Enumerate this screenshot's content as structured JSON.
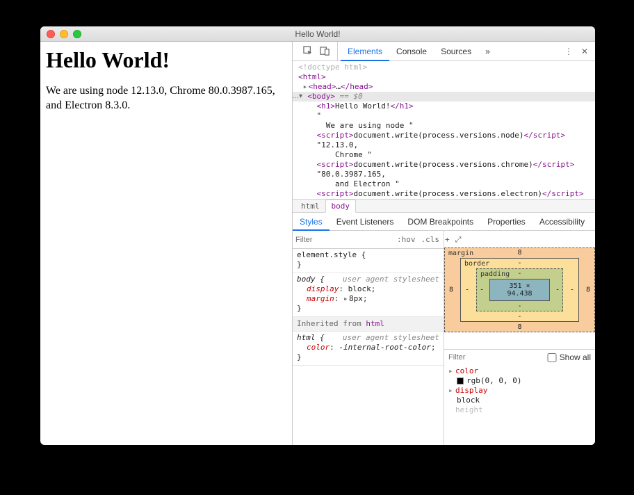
{
  "window": {
    "title": "Hello World!"
  },
  "page": {
    "heading": "Hello World!",
    "paragraph": "We are using node 12.13.0, Chrome 80.0.3987.165, and Electron 8.3.0."
  },
  "devtools": {
    "tabs": [
      "Elements",
      "Console",
      "Sources"
    ],
    "active_tab": 0,
    "elements_tree": {
      "doctype": "<!doctype html>",
      "html_open": "html",
      "head": {
        "open": "head",
        "ellipsis": "…",
        "close": "head"
      },
      "body_open": "body",
      "body_selected_suffix": " == $0",
      "h1": {
        "tag": "h1",
        "text": "Hello World!"
      },
      "quote1": "\"",
      "text_node1": "      We are using node \"",
      "script1": {
        "tag": "script",
        "code": "document.write(process.versions.node)"
      },
      "text_version_node": "\"12.13.0,",
      "text_chrome_label": "        Chrome \"",
      "script2": {
        "tag": "script",
        "code": "document.write(process.versions.chrome)"
      },
      "text_version_chrome": "\"80.0.3987.165,",
      "text_electron_label": "        and Electron \"",
      "script3": {
        "tag": "script",
        "code": "document.write(process.versions.electron)"
      }
    },
    "breadcrumbs": [
      "html",
      "body"
    ],
    "styles_tabs": [
      "Styles",
      "Event Listeners",
      "DOM Breakpoints",
      "Properties",
      "Accessibility"
    ],
    "filter_placeholder": "Filter",
    "hov_label": ":hov",
    "cls_label": ".cls",
    "rules": {
      "element_style": "element.style {",
      "body_sel": "body {",
      "ua_label": "user agent stylesheet",
      "body_display": {
        "name": "display",
        "value": "block"
      },
      "body_margin": {
        "name": "margin",
        "value": "8px"
      },
      "inherit_label": "Inherited from ",
      "inherit_link": "html",
      "html_sel": "html {",
      "html_color": {
        "name": "color",
        "value": "-internal-root-color"
      },
      "brace_close": "}"
    },
    "box_model": {
      "margin_label": "margin",
      "border_label": "border",
      "padding_label": "padding",
      "content": "351 × 94.438",
      "margin": {
        "top": "8",
        "right": "8",
        "bottom": "8",
        "left": "8"
      },
      "border": {
        "top": "-",
        "right": "-",
        "bottom": "-",
        "left": "-"
      },
      "padding": {
        "top": "-",
        "right": "-",
        "bottom": "-",
        "left": "-"
      }
    },
    "computed": {
      "filter_placeholder": "Filter",
      "show_all_label": "Show all",
      "props": [
        {
          "name": "color",
          "value": "rgb(0, 0, 0)",
          "has_swatch": true
        },
        {
          "name": "display",
          "value": "block"
        },
        {
          "name": "height",
          "muted": true
        }
      ]
    }
  }
}
